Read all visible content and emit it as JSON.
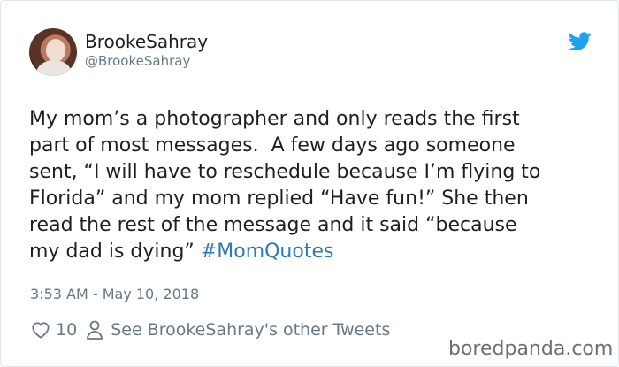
{
  "tweet": {
    "display_name": "BrookeSahray",
    "handle": "@BrookeSahray",
    "text_lines": [
      "My mom’s a photographer and only reads the first",
      "part of most messages.  A few days ago someone",
      "sent, “I will have to reschedule because I’m flying to",
      "Florida” and my mom replied “Have fun!” She then",
      "read the rest of the message and it said “because",
      "my dad is dying” "
    ],
    "hashtag": "#MomQuotes",
    "timestamp": "3:53 AM - May 10, 2018",
    "like_count": "10",
    "other_tweets_link": "See BrookeSahray's other Tweets"
  },
  "watermark": "boredpanda.com",
  "icons": {
    "brand": "twitter-bird-icon",
    "like": "heart-icon",
    "profile": "person-icon"
  },
  "colors": {
    "text": "#1c2022",
    "muted": "#697882",
    "link": "#2b7bb9",
    "twitter_blue": "#1da1f2"
  }
}
